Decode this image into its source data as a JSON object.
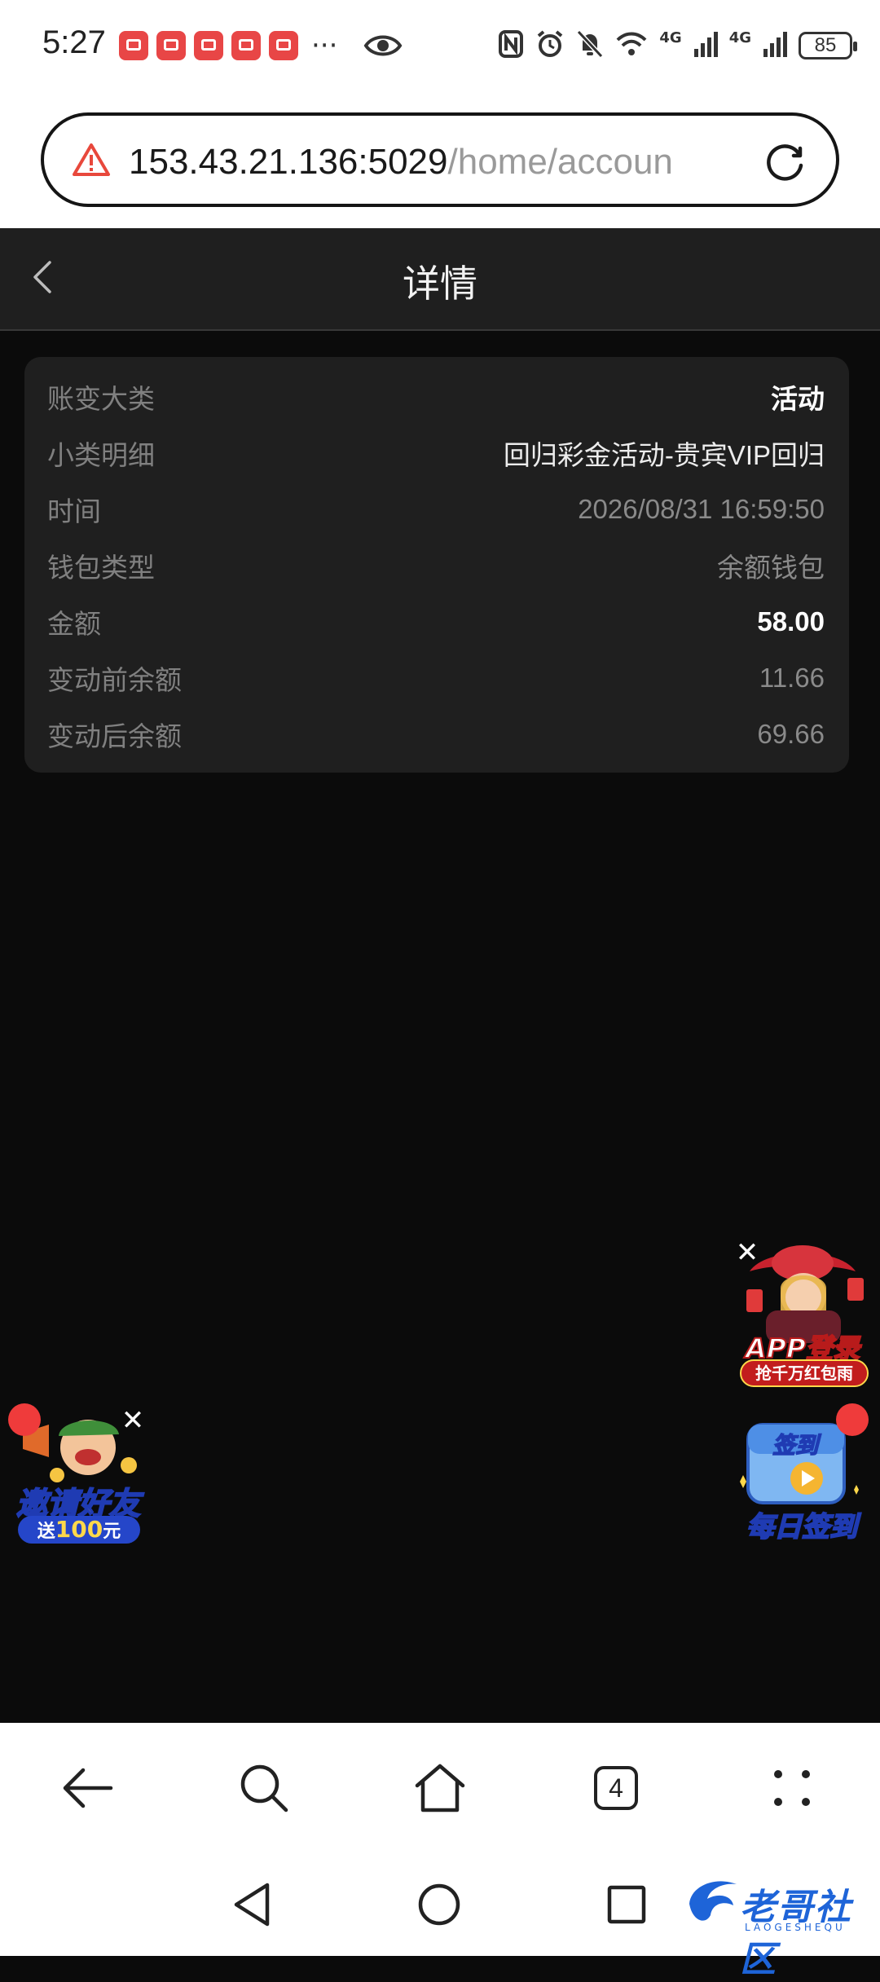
{
  "status_bar": {
    "time": "5:27",
    "overflow": "···",
    "network_label_1": "4G",
    "network_label_2": "4G",
    "battery": "85"
  },
  "address_bar": {
    "url_host": "153.43.21.136:5029",
    "url_path": "/home/accoun"
  },
  "header": {
    "title": "详情"
  },
  "details": {
    "rows": [
      {
        "label": "账变大类",
        "value": "活动"
      },
      {
        "label": "小类明细",
        "value": "回归彩金活动-贵宾VIP回归"
      },
      {
        "label": "时间",
        "value": "2026/08/31 16:59:50"
      },
      {
        "label": "钱包类型",
        "value": "余额钱包"
      },
      {
        "label": "金额",
        "value": "58.00"
      },
      {
        "label": "变动前余额",
        "value": "11.66"
      },
      {
        "label": "变动后余额",
        "value": "69.66"
      }
    ]
  },
  "promos": {
    "app_login": {
      "title": "APP登录",
      "subtitle": "抢千万红包雨"
    },
    "invite": {
      "title": "邀请好友",
      "subtitle_pre": "送",
      "subtitle_amount": "100",
      "subtitle_post": "元"
    },
    "checkin": {
      "badge": "签到",
      "title": "每日签到"
    }
  },
  "toolbar": {
    "tab_count": "4"
  },
  "watermark": {
    "main": "老哥社区",
    "sub": "LAOGESHEQU"
  },
  "colors": {
    "page_bg": "#0b0b0b",
    "card_bg": "#1f1f1f",
    "label": "#808080",
    "warning": "#e8483c",
    "watermark": "#1e64d8"
  }
}
